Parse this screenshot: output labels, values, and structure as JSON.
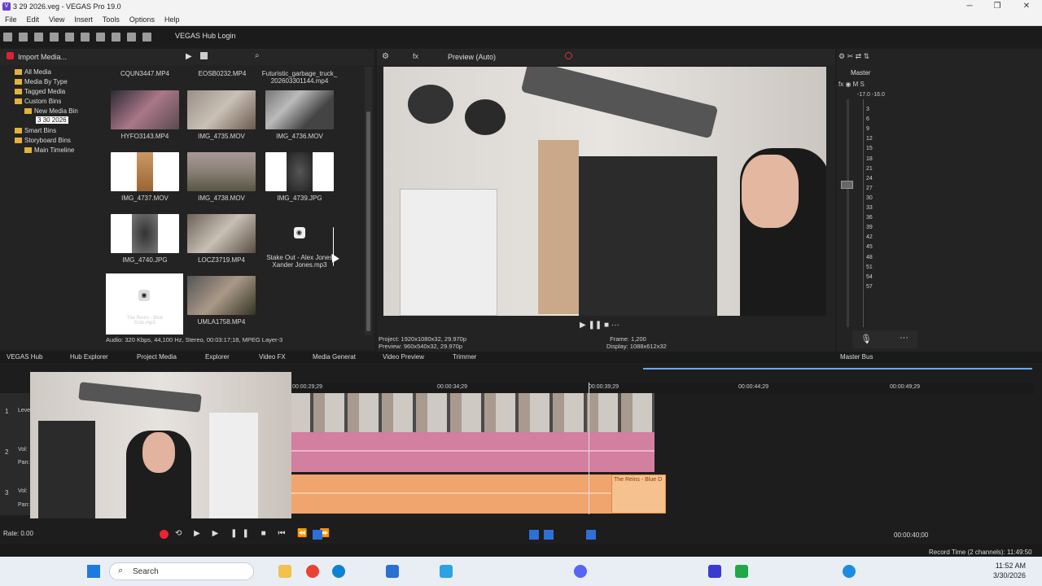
{
  "window": {
    "title": "3 29 2026.veg - VEGAS Pro 19.0"
  },
  "menu": [
    "File",
    "Edit",
    "View",
    "Insert",
    "Tools",
    "Options",
    "Help"
  ],
  "toolbar": {
    "hub_login": "VEGAS Hub Login"
  },
  "project_media": {
    "import_label": "Import Media...",
    "tree": [
      "All Media",
      "Media By Type",
      "Tagged Media",
      "Custom Bins",
      "New Media Bin",
      "3 30 2026",
      "Smart Bins",
      "Storyboard Bins",
      "Main Timeline"
    ],
    "items": [
      {
        "label": "CQUN3447.MP4"
      },
      {
        "label": "EOSB0232.MP4"
      },
      {
        "label": "Futuristic_garbage_truck_ 202603301144.mp4"
      },
      {
        "label": "HYFO3143.MP4"
      },
      {
        "label": "IMG_4735.MOV"
      },
      {
        "label": "IMG_4736.MOV"
      },
      {
        "label": "IMG_4737.MOV"
      },
      {
        "label": "IMG_4738.MOV"
      },
      {
        "label": "IMG_4739.JPG"
      },
      {
        "label": "IMG_4740.JPG"
      },
      {
        "label": "LOCZ3719.MP4"
      },
      {
        "label": "Stake Out - Alex Jones Xander Jones.mp3"
      },
      {
        "label": "The Reins - Blue Dots.mp3"
      },
      {
        "label": "UMLA1758.MP4"
      }
    ],
    "status": "Audio: 320 Kbps, 44,100 Hz, Stereo, 00:03:17;18, MPEG Layer-3"
  },
  "preview": {
    "mode": "Preview (Auto)",
    "project": "Project:",
    "project_value": "1920x1080x32, 29.970p",
    "preview": "Preview:",
    "preview_value": "960x540x32, 29.970p",
    "frame": "Frame:",
    "frame_value": "1,200",
    "display": "Display:",
    "display_value": "1088x612x32"
  },
  "master": {
    "title": "Master",
    "levels": "-17.0 -16.0",
    "ticks": [
      "3",
      "6",
      "9",
      "12",
      "15",
      "18",
      "21",
      "24",
      "27",
      "30",
      "33",
      "36",
      "39",
      "42",
      "45",
      "48",
      "51",
      "54",
      "57"
    ],
    "tab_label": "Master Bus"
  },
  "tabs": [
    "VEGAS Hub",
    "Hub Explorer",
    "Project Media",
    "Explorer",
    "Video FX",
    "Media Generat",
    "Video Preview",
    "Trimmer"
  ],
  "timeline": {
    "ruler": [
      "00:00:29;29",
      "00:00:34;29",
      "00:00:39;29",
      "00:00:44;29",
      "00:00:49;29"
    ],
    "audio_clip_label": "The Reins - Blue D",
    "track_numbers": [
      "1",
      "2",
      "3"
    ],
    "track_labels": [
      "Level:",
      "Vol:",
      "Pan:",
      "Vol:",
      "Pan:"
    ],
    "rate": "Rate: 0.00",
    "timecode": "00:00:40;00",
    "record_time": "Record Time (2 channels): 11:49:50"
  },
  "taskbar": {
    "search": "Search",
    "time": "11:52 AM",
    "date": "3/30/2026"
  }
}
